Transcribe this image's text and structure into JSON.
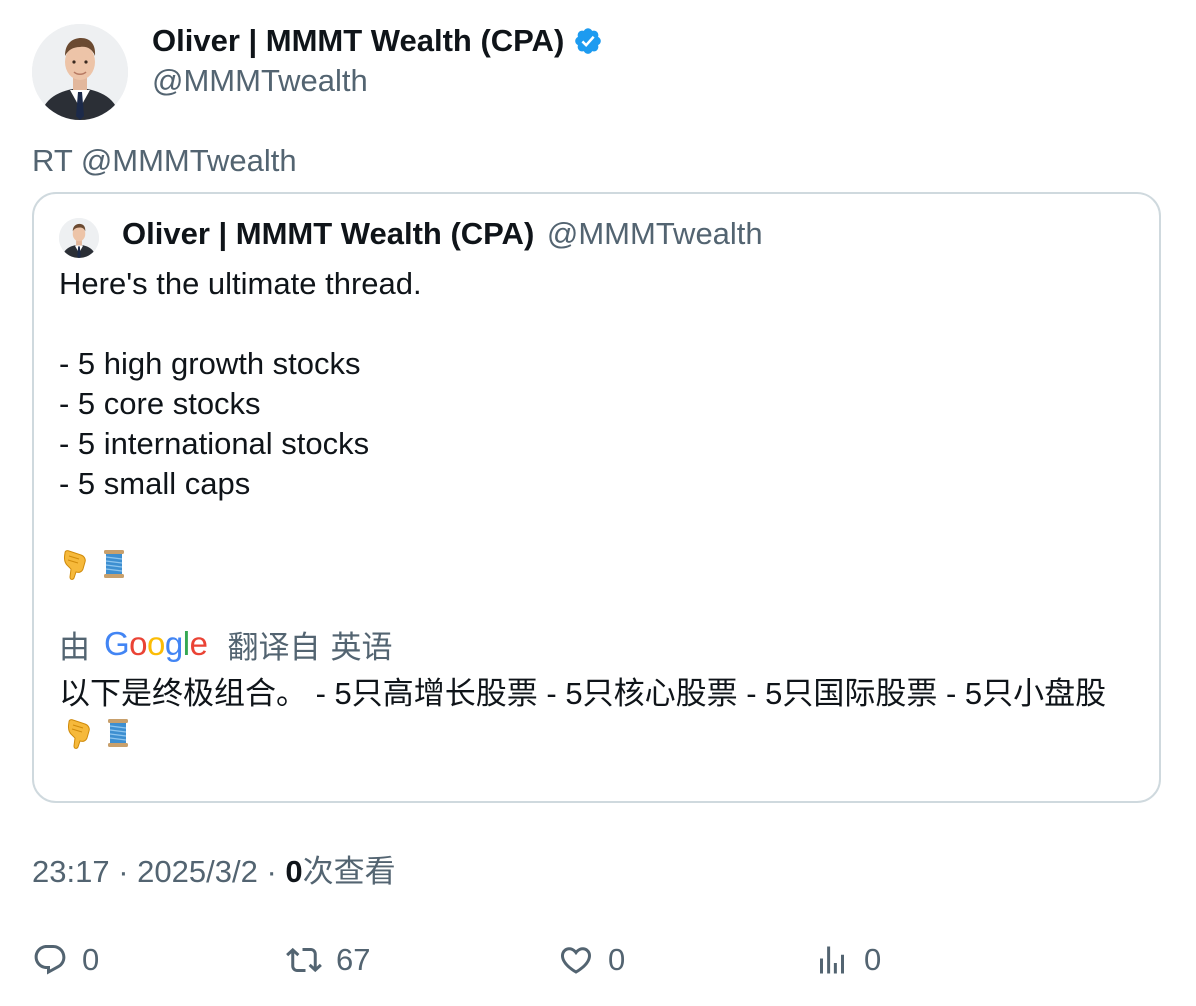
{
  "tweet": {
    "author": {
      "name": "Oliver | MMMT Wealth (CPA)",
      "handle": "@MMMTwealth",
      "verified": true,
      "verified_color": "#1d9bf0"
    },
    "retweet_line": "RT @MMMTwealth",
    "quoted": {
      "author_name": "Oliver | MMMT Wealth (CPA)",
      "author_handle": "@MMMTwealth",
      "lines": [
        "Here's the ultimate thread.",
        "",
        "- 5 high growth stocks",
        "- 5 core stocks",
        "- 5 international stocks",
        "- 5 small caps",
        ""
      ],
      "emojis": [
        "backhand-index-pointing-down",
        "spool-of-thread"
      ],
      "translation": {
        "by": "由",
        "provider": "Google",
        "from": "翻译自",
        "language": "英语",
        "text": "以下是终极组合。 - 5只高增长股票 - 5只核心股票 - 5只国际股票 - 5只小盘股"
      }
    },
    "meta": {
      "time": "23:17",
      "separator": "·",
      "date": "2025/3/2",
      "views_count": "0",
      "views_label": "次查看"
    },
    "actions": {
      "replies": "0",
      "retweets": "67",
      "likes": "0",
      "views": "0"
    }
  }
}
